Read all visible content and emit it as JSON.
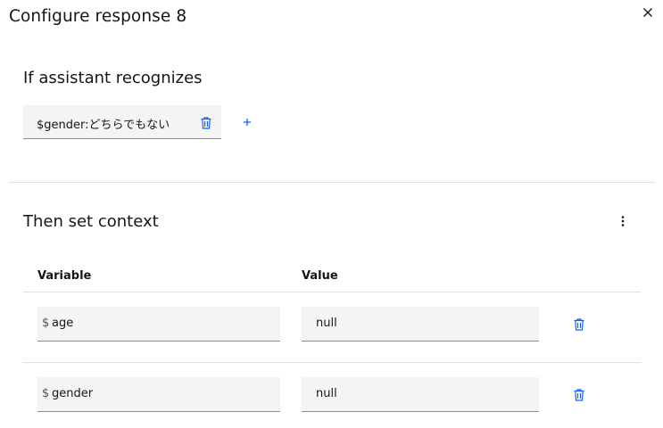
{
  "dialog": {
    "title": "Configure response 8"
  },
  "condition": {
    "heading": "If assistant recognizes",
    "tag_text": "$gender:どちらでもない"
  },
  "context": {
    "heading": "Then set context",
    "columns": {
      "variable": "Variable",
      "value": "Value"
    },
    "rows": [
      {
        "prefix": "$",
        "variable": "age",
        "value": "null"
      },
      {
        "prefix": "$",
        "variable": "gender",
        "value": "null"
      }
    ]
  },
  "icons": {
    "close": "close-icon",
    "delete": "trash-icon",
    "add": "plus-icon",
    "overflow": "overflow-menu-vertical-icon"
  },
  "colors": {
    "accent": "#0f62fe",
    "field_bg": "#f4f4f4",
    "divider": "#e0e0e0",
    "text": "#161616"
  }
}
